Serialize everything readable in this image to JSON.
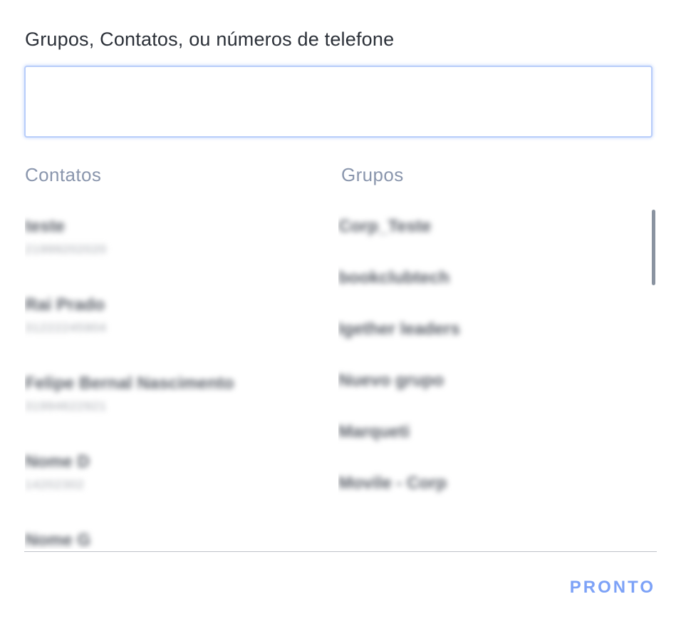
{
  "search": {
    "label": "Grupos, Contatos, ou números de telefone",
    "value": "",
    "placeholder": ""
  },
  "contacts": {
    "heading": "Contatos",
    "items": [
      {
        "name": "teste",
        "phone": "21999202020"
      },
      {
        "name": "Rai Prado",
        "phone": "31222245904"
      },
      {
        "name": "Felipe Bernal Nascimento",
        "phone": "31994622921"
      },
      {
        "name": "Nome D",
        "phone": "14202302"
      },
      {
        "name": "Nome G",
        "phone": ""
      }
    ]
  },
  "groups": {
    "heading": "Grupos",
    "items": [
      {
        "name": "Corp_Teste"
      },
      {
        "name": "bookclubtech"
      },
      {
        "name": "Igether leaders"
      },
      {
        "name": "Nuevo grupo"
      },
      {
        "name": "Marqueti"
      },
      {
        "name": "Movile - Corp"
      }
    ]
  },
  "footer": {
    "done_label": "PRONTO"
  },
  "colors": {
    "accent": "#7da2f7",
    "input_border": "#b8cdfa",
    "heading": "#8a96ad"
  }
}
